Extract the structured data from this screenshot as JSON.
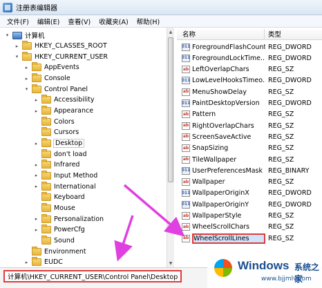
{
  "window": {
    "title": "注册表编辑器"
  },
  "menu": [
    "文件(F)",
    "编辑(E)",
    "查看(V)",
    "收藏夹(A)",
    "帮助(H)"
  ],
  "tree": [
    {
      "label": "计算机",
      "indent": 0,
      "icon": "computer",
      "expander": "▾"
    },
    {
      "label": "HKEY_CLASSES_ROOT",
      "indent": 1,
      "icon": "folder",
      "expander": "▸"
    },
    {
      "label": "HKEY_CURRENT_USER",
      "indent": 1,
      "icon": "folder",
      "expander": "▾"
    },
    {
      "label": "AppEvents",
      "indent": 2,
      "icon": "folder",
      "expander": "▸"
    },
    {
      "label": "Console",
      "indent": 2,
      "icon": "folder",
      "expander": "▸"
    },
    {
      "label": "Control Panel",
      "indent": 2,
      "icon": "folder",
      "expander": "▾"
    },
    {
      "label": "Accessibility",
      "indent": 3,
      "icon": "folder",
      "expander": "▸"
    },
    {
      "label": "Appearance",
      "indent": 3,
      "icon": "folder",
      "expander": "▸"
    },
    {
      "label": "Colors",
      "indent": 3,
      "icon": "folder",
      "expander": ""
    },
    {
      "label": "Cursors",
      "indent": 3,
      "icon": "folder",
      "expander": ""
    },
    {
      "label": "Desktop",
      "indent": 3,
      "icon": "folder",
      "expander": "▸",
      "selected": true
    },
    {
      "label": "don't load",
      "indent": 3,
      "icon": "folder",
      "expander": ""
    },
    {
      "label": "Infrared",
      "indent": 3,
      "icon": "folder",
      "expander": "▸"
    },
    {
      "label": "Input Method",
      "indent": 3,
      "icon": "folder",
      "expander": "▸"
    },
    {
      "label": "International",
      "indent": 3,
      "icon": "folder",
      "expander": "▸"
    },
    {
      "label": "Keyboard",
      "indent": 3,
      "icon": "folder",
      "expander": ""
    },
    {
      "label": "Mouse",
      "indent": 3,
      "icon": "folder",
      "expander": ""
    },
    {
      "label": "Personalization",
      "indent": 3,
      "icon": "folder",
      "expander": "▸"
    },
    {
      "label": "PowerCfg",
      "indent": 3,
      "icon": "folder",
      "expander": "▸"
    },
    {
      "label": "Sound",
      "indent": 3,
      "icon": "folder",
      "expander": ""
    },
    {
      "label": "Environment",
      "indent": 2,
      "icon": "folder",
      "expander": ""
    },
    {
      "label": "EUDC",
      "indent": 2,
      "icon": "folder",
      "expander": "▸"
    }
  ],
  "list": {
    "headers": {
      "name": "名称",
      "type": "类型"
    },
    "rows": [
      {
        "name": "ForegroundFlashCount",
        "type": "REG_DWORD",
        "kind": "bin"
      },
      {
        "name": "ForegroundLockTime...",
        "type": "REG_DWORD",
        "kind": "bin"
      },
      {
        "name": "LeftOverlapChars",
        "type": "REG_SZ",
        "kind": "sz"
      },
      {
        "name": "LowLevelHooksTimeo...",
        "type": "REG_DWORD",
        "kind": "bin"
      },
      {
        "name": "MenuShowDelay",
        "type": "REG_SZ",
        "kind": "sz"
      },
      {
        "name": "PaintDesktopVersion",
        "type": "REG_DWORD",
        "kind": "bin"
      },
      {
        "name": "Pattern",
        "type": "REG_SZ",
        "kind": "sz"
      },
      {
        "name": "RightOverlapChars",
        "type": "REG_SZ",
        "kind": "sz"
      },
      {
        "name": "ScreenSaveActive",
        "type": "REG_SZ",
        "kind": "sz"
      },
      {
        "name": "SnapSizing",
        "type": "REG_SZ",
        "kind": "sz"
      },
      {
        "name": "TileWallpaper",
        "type": "REG_SZ",
        "kind": "sz"
      },
      {
        "name": "UserPreferencesMask",
        "type": "REG_BINARY",
        "kind": "bin"
      },
      {
        "name": "Wallpaper",
        "type": "REG_SZ",
        "kind": "sz"
      },
      {
        "name": "WallpaperOriginX",
        "type": "REG_DWORD",
        "kind": "bin"
      },
      {
        "name": "WallpaperOriginY",
        "type": "REG_DWORD",
        "kind": "bin"
      },
      {
        "name": "WallpaperStyle",
        "type": "REG_SZ",
        "kind": "sz"
      },
      {
        "name": "WheelScrollChars",
        "type": "REG_SZ",
        "kind": "sz"
      },
      {
        "name": "WheelScrollLines",
        "type": "REG_SZ",
        "kind": "sz",
        "highlighted": true
      }
    ]
  },
  "statusbar": {
    "path": "计算机\\HKEY_CURRENT_USER\\Control Panel\\Desktop"
  },
  "watermark": {
    "brand": "Windows",
    "brand_cn": "系统之家",
    "url": "www.bjjmlv.com"
  },
  "colors": {
    "highlight_border": "#e03a3a",
    "arrow": "#e040e0",
    "watermark_text": "#1b4f8f"
  }
}
